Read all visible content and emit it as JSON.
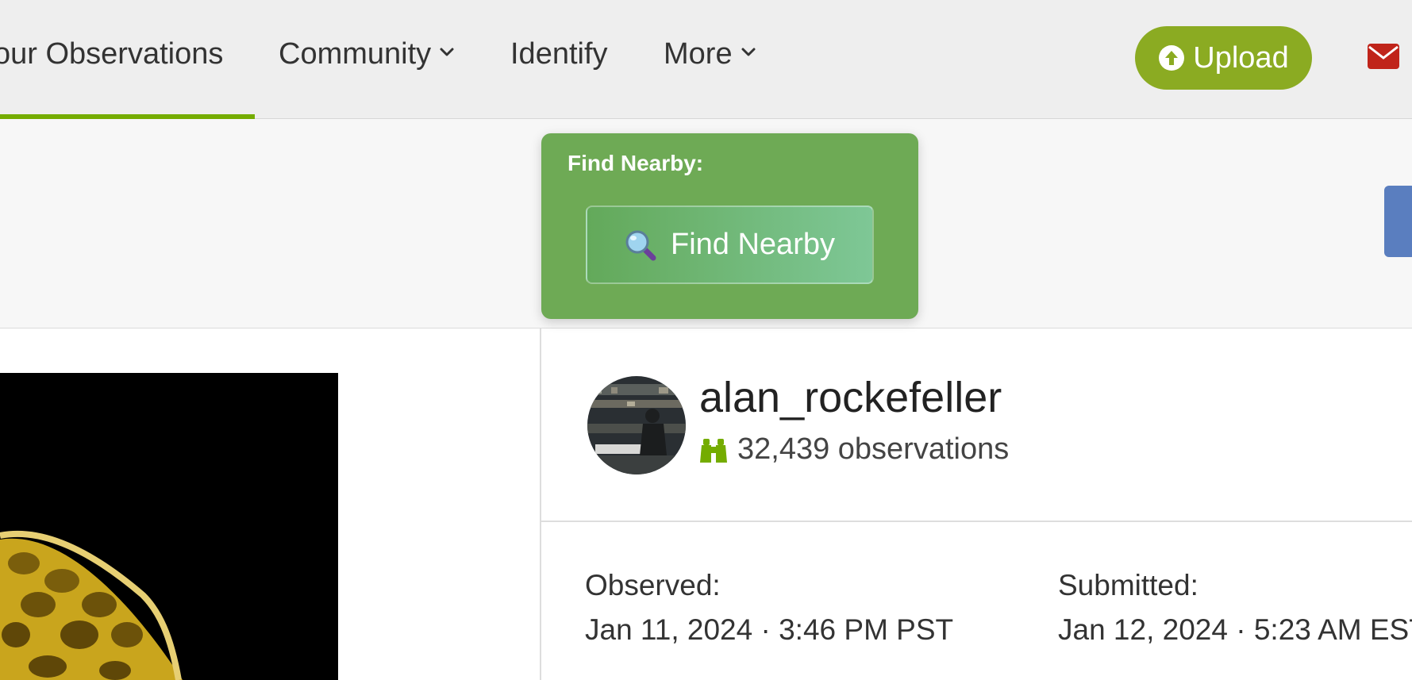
{
  "nav": {
    "items": [
      {
        "label": "our Observations"
      },
      {
        "label": "Community"
      },
      {
        "label": "Identify"
      },
      {
        "label": "More"
      }
    ],
    "upload_label": "Upload"
  },
  "find_nearby": {
    "heading": "Find Nearby:",
    "button_label": "Find Nearby"
  },
  "observer": {
    "username": "alan_rockefeller",
    "observations_count": "32,439 observations"
  },
  "dates": {
    "observed_label": "Observed:",
    "observed_value": "Jan 11, 2024 · 3:46 PM PST",
    "submitted_label": "Submitted:",
    "submitted_value": "Jan 12, 2024 · 5:23 AM EST"
  },
  "icons": {
    "upload": "upload-arrow-icon",
    "mail": "mail-icon",
    "search": "magnifier-icon",
    "observations": "binoculars-icon"
  },
  "colors": {
    "accent_green": "#74ac00",
    "upload_bg": "#8bab22",
    "find_panel_bg": "#6eaa55",
    "mail_red": "#c0241a"
  }
}
